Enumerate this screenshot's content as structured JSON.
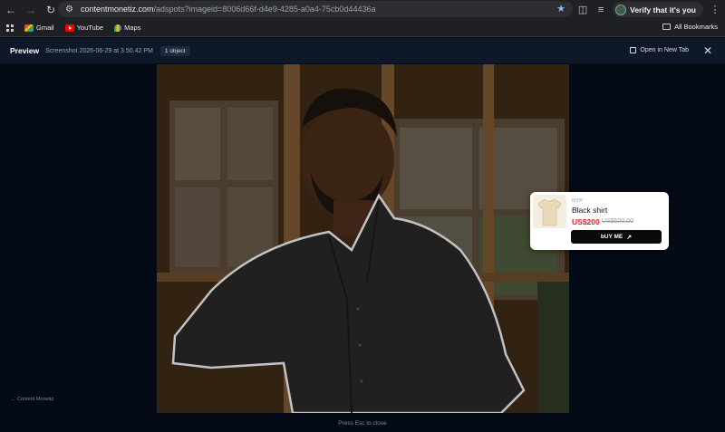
{
  "browser": {
    "url_host": "contentmonetiz.com",
    "url_path": "/adspots?imageid=8006d66f-d4e9-4285-a0a4-75cb0d44436a",
    "verify_label": "Verify that it's you"
  },
  "bookmarks": {
    "items": [
      {
        "label": "Gmail",
        "icon": "gmail-icon"
      },
      {
        "label": "YouTube",
        "icon": "youtube-icon"
      },
      {
        "label": "Maps",
        "icon": "maps-icon"
      }
    ],
    "all_label": "All Bookmarks"
  },
  "preview": {
    "title": "Preview",
    "subtitle": "Screenshot 2026-06-29 at 3.50.42 PM",
    "object_count": "1 object",
    "open_new_tab": "Open in New Tab"
  },
  "product": {
    "brand": "NYP",
    "name": "Black shirt",
    "price": "US$200",
    "old_price": "US$500.00",
    "buy_label": "bUY ME"
  },
  "footer": {
    "brand": "Content Monetiz",
    "hint": "Press Esc to close"
  },
  "colors": {
    "page_bg": "#050b16",
    "header_bg": "#0f1828",
    "price_red": "#e02424",
    "star_blue": "#8ab4f8"
  }
}
